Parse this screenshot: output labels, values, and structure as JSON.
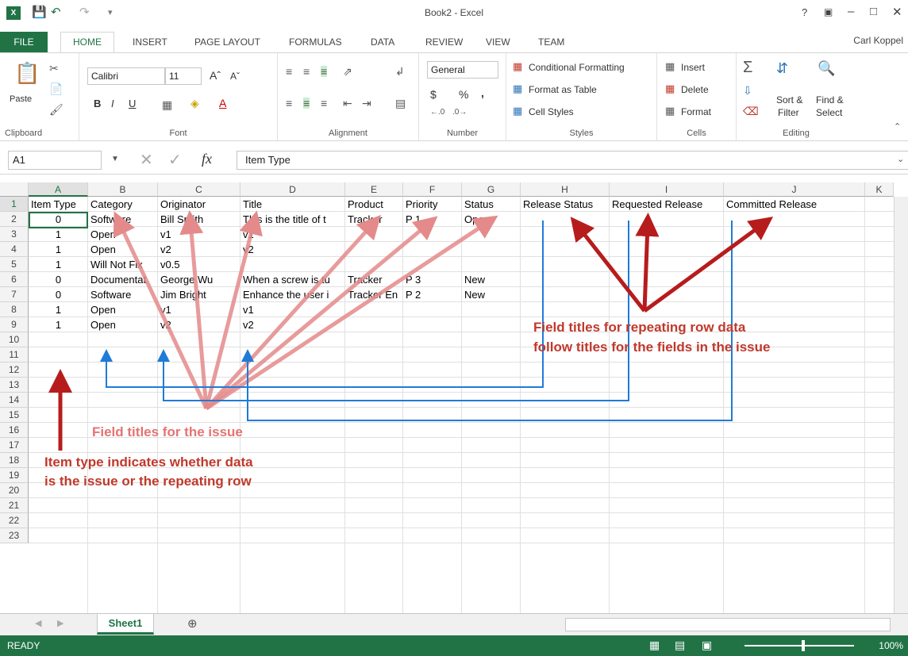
{
  "window": {
    "title": "Book2 - Excel",
    "help": "?",
    "user": "Carl Koppel"
  },
  "tabs": [
    "FILE",
    "HOME",
    "INSERT",
    "PAGE LAYOUT",
    "FORMULAS",
    "DATA",
    "REVIEW",
    "VIEW",
    "TEAM"
  ],
  "ribbon": {
    "clipboard": {
      "paste": "Paste",
      "label": "Clipboard"
    },
    "font": {
      "name": "Calibri",
      "size": "11",
      "label": "Font",
      "bold": "B",
      "italic": "I",
      "underline": "U"
    },
    "alignment": {
      "label": "Alignment"
    },
    "number": {
      "format": "General",
      "currency": "$",
      "percent": "%",
      "comma": ",",
      "label": "Number"
    },
    "styles": {
      "conditional": "Conditional Formatting",
      "table": "Format as Table",
      "cell_styles": "Cell Styles",
      "label": "Styles"
    },
    "cells": {
      "insert": "Insert",
      "delete": "Delete",
      "format": "Format",
      "label": "Cells"
    },
    "editing": {
      "sort": "Sort &",
      "filter": "Filter",
      "find": "Find &",
      "select": "Select",
      "label": "Editing"
    }
  },
  "formula_bar": {
    "name_box": "A1",
    "fx": "fx",
    "content": "Item Type"
  },
  "columns": [
    "A",
    "B",
    "C",
    "D",
    "E",
    "F",
    "G",
    "H",
    "I",
    "J",
    "K"
  ],
  "rows": [
    "1",
    "2",
    "3",
    "4",
    "5",
    "6",
    "7",
    "8",
    "9",
    "10",
    "11",
    "12",
    "13",
    "14",
    "15",
    "16",
    "17",
    "18",
    "19",
    "20",
    "21",
    "22",
    "23"
  ],
  "cells": {
    "r1": [
      "Item Type",
      "Category",
      "Originator",
      "Title",
      "Product",
      "Priority",
      "Status",
      "Release Status",
      "Requested Release",
      "Committed Release"
    ],
    "r2": [
      "0",
      "Software",
      "Bill Smith",
      "This is the title of t",
      "Tracker",
      "P 1",
      "Open"
    ],
    "r3": [
      "1",
      "Open",
      "v1",
      "v1"
    ],
    "r4": [
      "1",
      "Open",
      "v2",
      "v2"
    ],
    "r5": [
      "1",
      "Will Not Fix",
      "v0.5"
    ],
    "r6": [
      "0",
      "Documentat",
      "George Wu",
      "When a screw is tu",
      "Tracker",
      "P 3",
      "New"
    ],
    "r7": [
      "0",
      "Software",
      "Jim Bright",
      "Enhance the user i",
      "Tracker En",
      "P 2",
      "New"
    ],
    "r8": [
      "1",
      "Open",
      "v1",
      "v1"
    ],
    "r9": [
      "1",
      "Open",
      "v2",
      "v2"
    ]
  },
  "annotations": {
    "field_titles_issue": "Field titles for the issue",
    "repeating_line1": "Field titles for repeating row data",
    "repeating_line2": "follow titles for the fields in the issue",
    "item_type_line1": "Item type indicates whether data",
    "item_type_line2": "is the issue or the repeating row"
  },
  "sheet_tabs": [
    "Sheet1"
  ],
  "status": {
    "ready": "READY",
    "zoom": "100%"
  },
  "colors": {
    "excel_green": "#217346",
    "annotation_red": "#c0392b",
    "arrow_red": "#b71c1c",
    "arrow_pink": "#e57373",
    "blue_connector": "#1e7bd8"
  }
}
